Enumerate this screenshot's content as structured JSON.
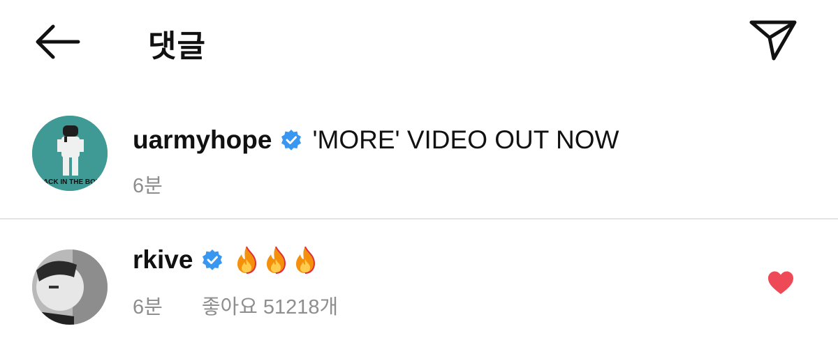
{
  "header": {
    "title": "댓글",
    "back_icon": "arrow-left-icon",
    "send_icon": "paper-plane-icon"
  },
  "comments": [
    {
      "username": "uarmyhope",
      "verified": true,
      "text": "'MORE' VIDEO OUT NOW",
      "time": "6분",
      "avatar_text": "JACK IN THE BOX"
    },
    {
      "username": "rkive",
      "verified": true,
      "emojis": [
        "fire-icon",
        "fire-icon",
        "fire-icon"
      ],
      "time": "6분",
      "likes": "좋아요 51218개",
      "liked": true
    }
  ],
  "colors": {
    "verified": "#3897f0",
    "like": "#ed4956",
    "meta": "#8e8e8e",
    "avatar1_bg": "#3f9a95"
  }
}
